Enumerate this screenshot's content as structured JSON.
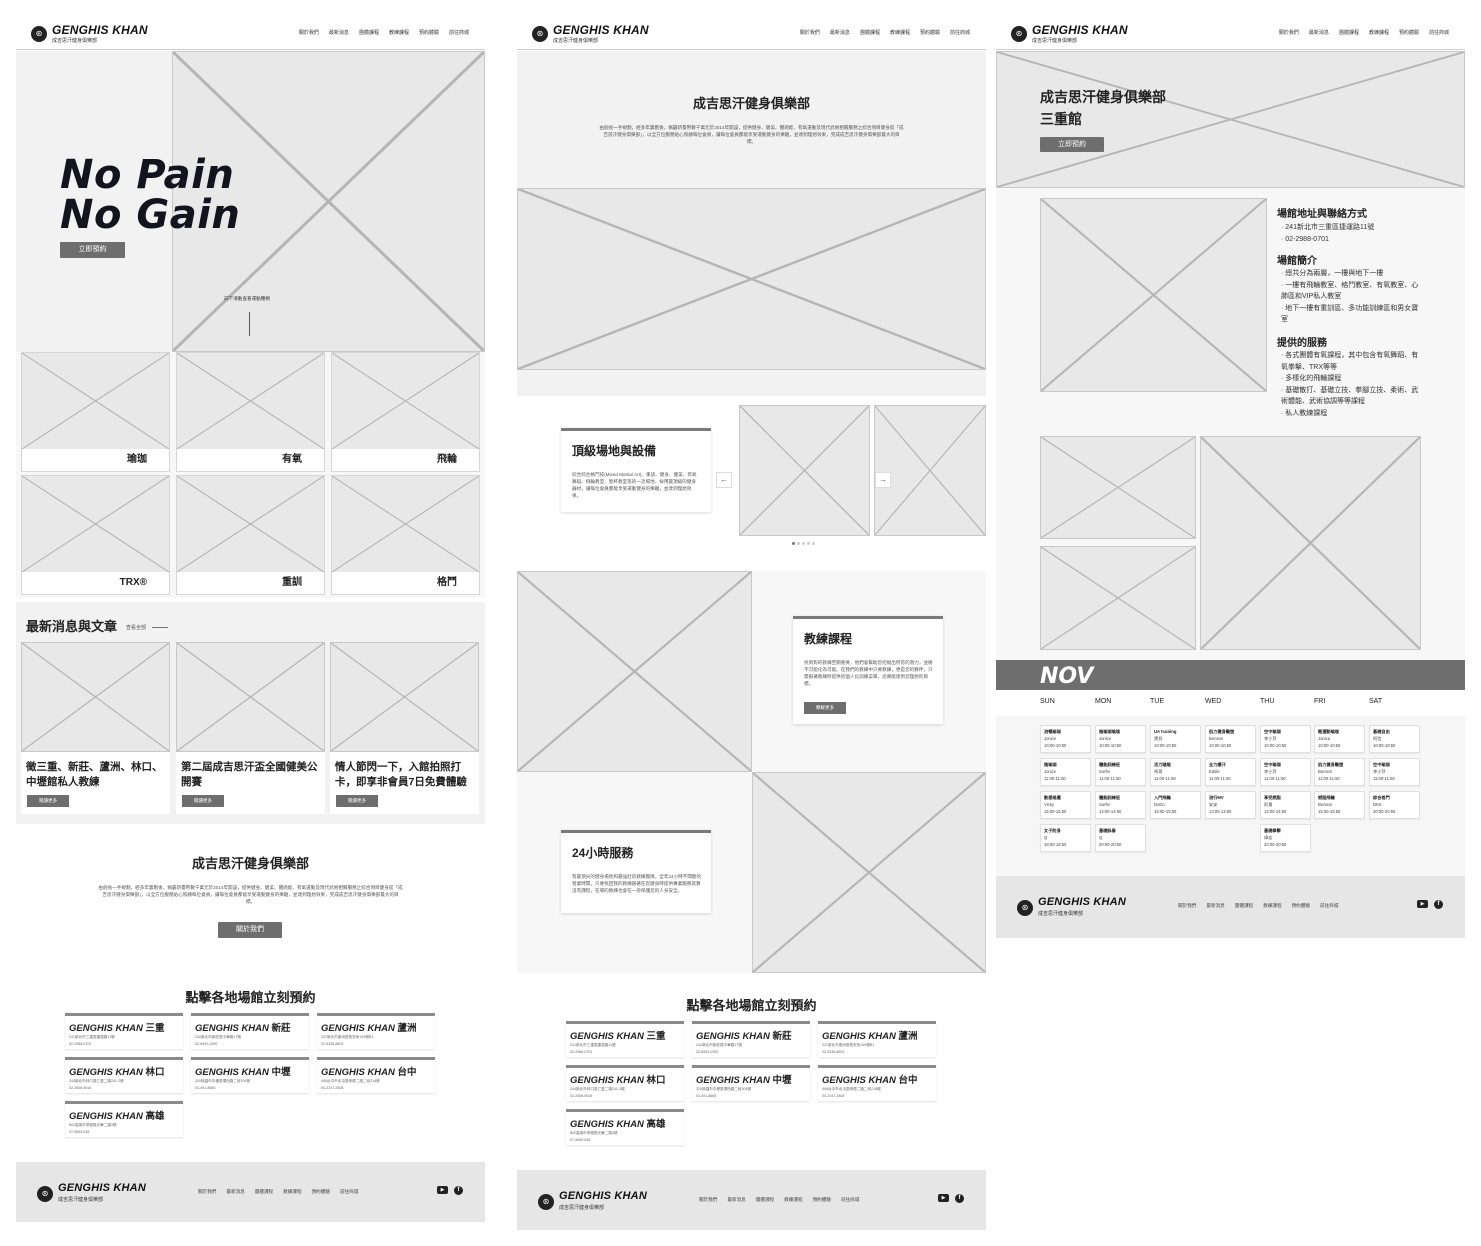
{
  "brand": {
    "name": "GENGHIS KHAN",
    "sub": "成吉思汗健身俱樂部",
    "mark": "⊛"
  },
  "nav": [
    "關於我們",
    "最新消息",
    "團體課程",
    "教練課程",
    "預約體驗",
    "前往商城"
  ],
  "home": {
    "hero_line1": "No Pain",
    "hero_line2": "No Gain",
    "hero_button": "立即預約",
    "scroll_hint": "向下滑動查看運動種類",
    "categories": [
      "瑜珈",
      "有氧",
      "飛輪",
      "TRX®",
      "重訓",
      "格鬥"
    ],
    "news_title": "最新消息與文章",
    "news_link": "查看全部",
    "news": [
      {
        "title": "徵三重、新莊、蘆洲、林口、中壢館私人教練",
        "button": "閱讀更多"
      },
      {
        "title": "第二屆成吉思汗盃全國健美公開賽",
        "button": "閱讀更多"
      },
      {
        "title": "情人節閃一下，入館拍照打卡，即享非會員7日免費體驗",
        "button": "閱讀更多"
      }
    ],
    "about_title": "成吉思汗健身俱樂部",
    "about_text": "由創長一手規劃，經多年籌劃後，稱霸新臺幣數千萬元於2014年開設，提供健身、健美、體適能、有氧運動及現代武術相關服務之綜合項目健身館「成吉思汗健身俱樂部」，以全方位服務貼心照顧每位會員，讓每位會員都能享受運動健身的樂趣，並達到理想效果，完成成吉思汗健身俱樂部最大的目標。",
    "about_button": "關於我們",
    "booking_title": "點擊各地場館立刻預約"
  },
  "locations": [
    {
      "city": "三重",
      "addr": "241新北市三重區捷運路11號",
      "tel": "02-2988-0701"
    },
    {
      "city": "新莊",
      "addr": "242新北市新莊區中華路17號",
      "tel": "02-8992-0390"
    },
    {
      "city": "蘆洲",
      "addr": "247新北市蘆洲區長安街159號B1",
      "tel": "02-5336-6603"
    },
    {
      "city": "林口",
      "addr": "244新北市林口區仁愛二路241-2號",
      "tel": "02-2606-9016"
    },
    {
      "city": "中壢",
      "addr": "320桃園市中壢區環西路二段304號",
      "tel": "03-491-8665"
    },
    {
      "city": "台中",
      "addr": "406台中市北屯區崇德二路二段218號",
      "tel": "04-2247-2808"
    },
    {
      "city": "高雄",
      "addr": "802高雄市苓雅區光華二路3號",
      "tel": "07-5569-638"
    }
  ],
  "about": {
    "title": "成吉思汗健身俱樂部",
    "text": "由創長一手規劃，經多年籌劃後，稱霸新臺幣數千萬元於2014年開設，提供健身、健美、體適能、有氧運動及現代武術相關服務之綜合項目健身館「成吉思汗健身俱樂部」，以全方位服務貼心照顧每位會員，讓每位會員都能享受運動健身的樂趣，並達到理想效果，完成成吉思汗健身俱樂部最大的目標。",
    "facility_title": "頂級場地與設備",
    "facility_text": "綜合綜合格鬥技(Mixed Martial Art)、重訓、健身、健美、有氧舞蹈、飛輪教室、墊杯教室等的一流場地，採用最頂級的健身器材，讓每位會員都能享受運動健身的樂趣，並達到理想效果。",
    "coach_title": "教練課程",
    "coach_text": "找到對的教練至關重要，他們會幫助您挖掘出所有的潛力，並將不可能化為可能。在我們的教練中只要教練，更是您的夥伴，只需跟著教練所提供的個人化訓練菜單，您將能達到您理想的目標。",
    "coach_button": "瞭解更多",
    "service_title": "24小時服務",
    "service_text": "有最頂尖的健身場地和最強壯的教練團隊，全年24小時不間斷的營業時間，只要找回我的教練跟著在您健身時提供專業服務就算沒有課程，在場的教練也會在一旁保護您的人身安全。",
    "arrow_left": "←",
    "arrow_right": "→",
    "booking_title": "點擊各地場館立刻預約"
  },
  "branch": {
    "title1": "成吉思汗健身俱樂部",
    "title2": "三重館",
    "button": "立即預約",
    "addr_title": "場館地址與聯絡方式",
    "addr_items": [
      "241新北市三重區捷運路11號",
      "02-2988-0701"
    ],
    "intro_title": "場館簡介",
    "intro_items": [
      "總共分為兩層，一樓與地下一樓",
      "一樓有飛輪教室、格鬥教室、有氧教室、心肺區和VIP私人教室",
      "地下一樓有重訓區、多功能訓練區和男女寶室"
    ],
    "service_title": "提供的服務",
    "service_items": [
      "各式團體有氧課程，其中包含有氧舞蹈、有氧拳擊、TRX等等",
      "多樣化的飛輪課程",
      "基礎散打、基礎立技、拳腳立技、柔術、武術體能、武術協調等等課程",
      "私人教練課程"
    ],
    "month": "NOV",
    "days": [
      "SUN",
      "MON",
      "TUE",
      "WED",
      "THU",
      "FRI",
      "SAT"
    ],
    "schedule": [
      [
        {
          "t": "流暢瑜珈",
          "c": "Jonice",
          "h": "10:00-10:50"
        },
        {
          "t": "陰瑜珈",
          "c": "Jonice",
          "h": "11:00-11:50"
        },
        {
          "t": "動感搖擺",
          "c": "Vicky",
          "h": "15:00-15:50"
        },
        {
          "t": "女子防身",
          "c": "Q",
          "h": "18:00-18:50"
        }
      ],
      [
        {
          "t": "陰瑜珈瑜珈",
          "c": "Jonice",
          "h": "10:00-10:50"
        },
        {
          "t": "體能訓練班",
          "c": "Surfer",
          "h": "11:00-11:50"
        },
        {
          "t": "體能訓練班",
          "c": "Surfer",
          "h": "14:00-14:50"
        },
        {
          "t": "基礎詠春",
          "c": "Q",
          "h": "20:00-20:50"
        }
      ],
      [
        {
          "t": "UA training",
          "c": "寶貝",
          "h": "10:00-10:50"
        },
        {
          "t": "活力踏階",
          "c": "馬蒂",
          "h": "11:00-11:50"
        },
        {
          "t": "入門飛輪",
          "c": "DoDo",
          "h": "15:00-15:50"
        }
      ],
      [
        {
          "t": "肌力健身雕塑",
          "c": "Benson",
          "h": "10:00-10:50"
        },
        {
          "t": "全力爆汗",
          "c": "Eddie",
          "h": "11:00-11:50"
        },
        {
          "t": "流行MV",
          "c": "安安",
          "h": "13:00-13:50"
        }
      ],
      [
        {
          "t": "空中瑜珈",
          "c": "李小芽",
          "h": "10:00-10:50"
        },
        {
          "t": "空中瑜珈",
          "c": "李小芽",
          "h": "11:00-11:50"
        },
        {
          "t": "享受燃脂",
          "c": "阿貴",
          "h": "14:00-14:50"
        },
        {
          "t": "基礎拳擊",
          "c": "偉宏",
          "h": "20:00-20:50"
        }
      ],
      [
        {
          "t": "輕運動瑜珈",
          "c": "Jonica",
          "h": "10:00-10:50"
        },
        {
          "t": "肌力健身雕塑",
          "c": "Benson",
          "h": "11:00-11:50"
        },
        {
          "t": "燃脂飛輪",
          "c": "Benson",
          "h": "15:00-15:50"
        }
      ],
      [
        {
          "t": "基礎自由",
          "c": "阿信",
          "h": "10:00-10:50"
        },
        {
          "t": "空中瑜珈",
          "c": "李小芽",
          "h": "11:00-11:50"
        },
        {
          "t": "綜合格鬥",
          "c": "DKK",
          "h": "20:00-20:50"
        }
      ]
    ]
  },
  "footer": {
    "youtube": "▶",
    "facebook": "f"
  }
}
